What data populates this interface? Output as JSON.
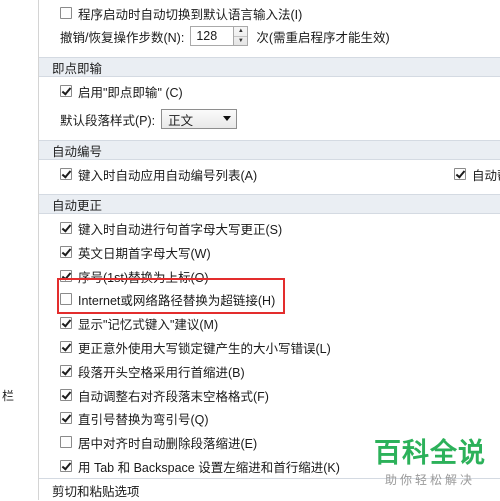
{
  "left_pane": {
    "stub_text": "栏"
  },
  "ime_row": {
    "label": "程序启动时自动切换到默认语言输入法(I)",
    "checked": false
  },
  "undo_row": {
    "label": "撤销/恢复操作步数(N):",
    "value": "128",
    "suffix": "次(需重启程序才能生效)"
  },
  "sections": {
    "click_type": "即点即输",
    "auto_number": "自动编号",
    "auto_correct": "自动更正",
    "cut_paste": "剪切和粘贴选项"
  },
  "click_type": {
    "enable_label": "启用\"即点即输\" (C)",
    "enable_checked": true,
    "default_style_label": "默认段落样式(P):",
    "default_style_value": "正文"
  },
  "auto_number": {
    "apply_list_label": "键入时自动应用自动编号列表(A)",
    "apply_list_checked": true,
    "right_label": "自动帮",
    "right_checked": true
  },
  "auto_correct_items": [
    {
      "label": "键入时自动进行句首字母大写更正(S)",
      "checked": true
    },
    {
      "label": "英文日期首字母大写(W)",
      "checked": true
    },
    {
      "label": "序号(1st)替换为上标(O)",
      "checked": true
    },
    {
      "label": "Internet或网络路径替换为超链接(H)",
      "checked": false
    },
    {
      "label": "显示\"记忆式键入\"建议(M)",
      "checked": true
    },
    {
      "label": "更正意外使用大写锁定键产生的大小写错误(L)",
      "checked": true
    },
    {
      "label": "段落开头空格采用行首缩进(B)",
      "checked": true
    },
    {
      "label": "自动调整右对齐段落末空格格式(F)",
      "checked": true
    },
    {
      "label": "直引号替换为弯引号(Q)",
      "checked": true
    },
    {
      "label": "居中对齐时自动删除段落缩进(E)",
      "checked": false
    },
    {
      "label": "用 Tab 和 Backspace 设置左缩进和首行缩进(K)",
      "checked": true
    }
  ],
  "watermark": {
    "title": "百科全说",
    "subtitle": "助你轻松解决"
  },
  "colors": {
    "section_bg": "#eaeef3",
    "highlight": "#e32d2d",
    "watermark": "#2cb15a"
  }
}
